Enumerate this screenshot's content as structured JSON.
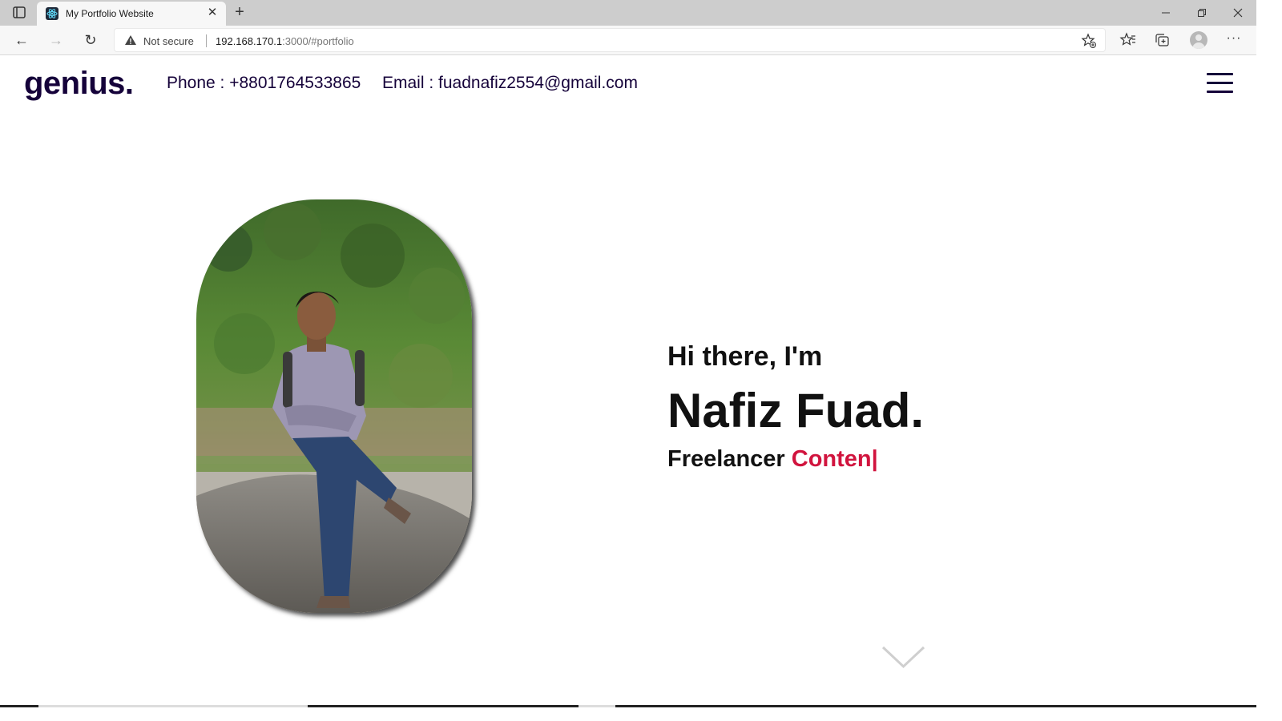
{
  "browser": {
    "tab_title": "My Portfolio Website",
    "tab_close": "✕",
    "new_tab": "+",
    "window_controls": {
      "minimize": "—",
      "restore": "❐",
      "close": "✕"
    },
    "nav": {
      "back": "←",
      "forward": "→",
      "reload": "↻",
      "more": "···"
    },
    "security_label": "Not secure",
    "url_host": "192.168.170.1",
    "url_rest": ":3000/#portfolio",
    "icons": [
      "tab-actions-icon",
      "favicon-icon",
      "warning-icon",
      "add-favorite-icon",
      "favorites-icon",
      "collections-icon",
      "profile-icon",
      "more-icon"
    ]
  },
  "header": {
    "logo": "genius.",
    "phone": "Phone : +8801764533865",
    "email": "Email : fuadnafiz2554@gmail.com",
    "menu_icon": "hamburger-menu-icon"
  },
  "hero": {
    "greeting": "Hi there, I'm",
    "name": "Nafiz Fuad.",
    "role_prefix": "Freelancer",
    "role_typed": "Conten|",
    "scroll_icon": "chevron-down-icon"
  },
  "colors": {
    "brand_dark": "#15023a",
    "accent": "#d1143e",
    "text": "#111111"
  }
}
